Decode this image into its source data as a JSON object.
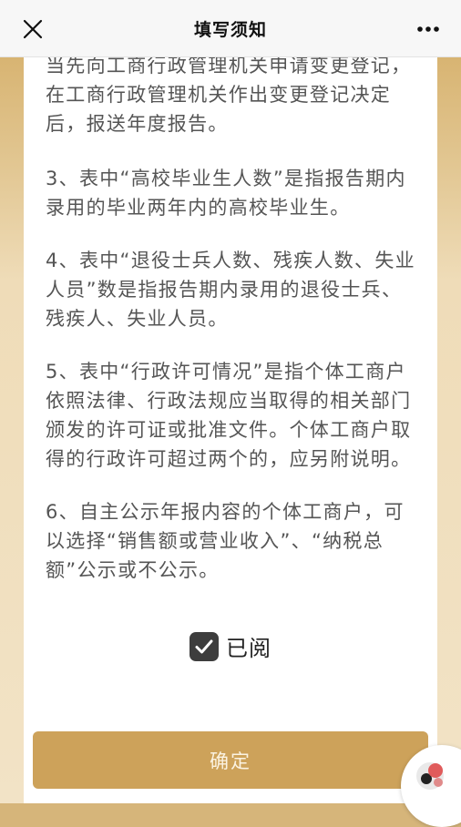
{
  "header": {
    "title": "填写须知",
    "close_icon": "close-icon",
    "more_icon": "more-icon"
  },
  "content": {
    "paragraphs": [
      "当先向工商行政管理机关申请变更登记，在工商行政管理机关作出变更登记决定后，报送年度报告。",
      "3、表中“高校毕业生人数”是指报告期内录用的毕业两年内的高校毕业生。",
      "4、表中“退役士兵人数、残疾人数、失业人员”数是指报告期内录用的退役士兵、残疾人、失业人员。",
      "5、表中“行政许可情况”是指个体工商户依照法律、行政法规应当取得的相关部门颁发的许可证或批准文件。个体工商户取得的行政许可超过两个的，应另附说明。",
      "6、自主公示年报内容的个体工商户，可以选择“销售额或营业收入”、“纳税总额”公示或不公示。"
    ]
  },
  "read_checkbox": {
    "label": "已阅",
    "checked": true
  },
  "footer": {
    "confirm_label": "确定"
  },
  "colors": {
    "accent": "#cda25a",
    "background": "#d6b57a"
  }
}
